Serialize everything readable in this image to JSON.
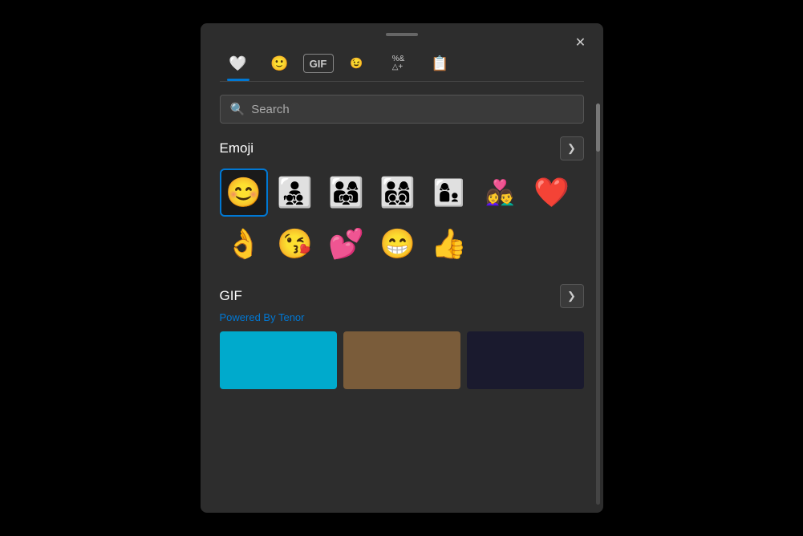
{
  "panel": {
    "close_label": "✕"
  },
  "tabs": [
    {
      "id": "recently-used",
      "icon": "🤍",
      "active": true,
      "label": "Recently Used"
    },
    {
      "id": "emoji",
      "icon": "🙂",
      "active": false,
      "label": "Emoji"
    },
    {
      "id": "gif",
      "icon": "GIF",
      "active": false,
      "label": "GIF",
      "text": true
    },
    {
      "id": "kaomoji",
      "icon": ";-)",
      "active": false,
      "label": "Kaomoji",
      "text": true
    },
    {
      "id": "symbols",
      "icon": "※",
      "active": false,
      "label": "Symbols",
      "text_special": true
    },
    {
      "id": "clipboard",
      "icon": "📋",
      "active": false,
      "label": "Clipboard"
    }
  ],
  "search": {
    "placeholder": "Search",
    "icon": "🔍"
  },
  "emoji_section": {
    "title": "Emoji",
    "chevron": "❯",
    "items": [
      {
        "char": "😊",
        "label": "smiling face with smiling eyes",
        "selected": true
      },
      {
        "char": "👨‍👧‍👦",
        "label": "family man girl boy"
      },
      {
        "char": "👨‍👩‍👧",
        "label": "family man woman girl"
      },
      {
        "char": "👨‍👩‍👦‍👦",
        "label": "family man woman boy boy"
      },
      {
        "char": "👨‍👩‍👧‍👦",
        "label": "family man woman girl boy"
      },
      {
        "char": "👩‍❤️‍👨",
        "label": "couple with heart woman man"
      },
      {
        "char": "❤️",
        "label": "red heart"
      },
      {
        "char": "👌",
        "label": "ok hand"
      },
      {
        "char": "😘",
        "label": "face blowing a kiss"
      },
      {
        "char": "💕",
        "label": "two hearts"
      },
      {
        "char": "😁",
        "label": "beaming face with smiling eyes"
      },
      {
        "char": "👍",
        "label": "thumbs up"
      }
    ]
  },
  "gif_section": {
    "title": "GIF",
    "chevron": "❯",
    "powered_by": "Powered By Tenor"
  }
}
